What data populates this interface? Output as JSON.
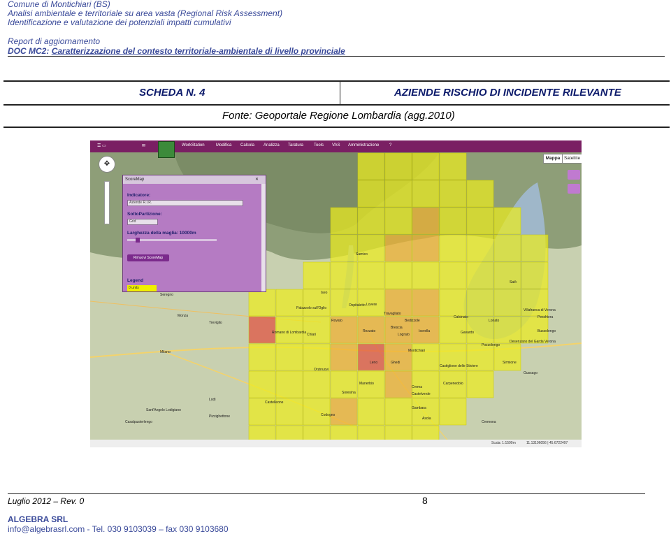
{
  "header": {
    "line1": "Comune di Montichiari (BS)",
    "line2": "Analisi ambientale e territoriale su area vasta (Regional Risk Assessment)",
    "line3": "Identificazione e valutazione dei potenziali impatti cumulativi",
    "line4": "Report di aggiornamento",
    "line5_prefix": "DOC MC2:",
    "line5_title": "Caratterizzazione del contesto territoriale-ambientale di livello provinciale"
  },
  "scheda": {
    "number": "SCHEDA N. 4",
    "title": "AZIENDE RISCHIO DI INCIDENTE RILEVANTE",
    "source": "Fonte: Geoportale Regione Lombardia (agg.2010)"
  },
  "map": {
    "toolbar": [
      "WorkStation",
      "Modifica",
      "Calcola",
      "Analizza",
      "Taratura",
      "Tools",
      "VAS",
      "Amministrazione",
      "?"
    ],
    "map_types": [
      "Mappa",
      "Satellite"
    ],
    "panel": {
      "title": "ScoreMap",
      "indicator_label": "Indicatore:",
      "indicator_value": "Aziende R.I.R.",
      "subpartition_label": "SottoPartizione:",
      "subpartition_value": "Grid",
      "mesh_label": "Larghezza della maglia: 10000m",
      "remove_button": "Rimuovi ScoreMap",
      "legend_label": "Legend",
      "legend_item": "0 units"
    },
    "place_labels": [
      "Milano",
      "Monza",
      "Seregno",
      "Brescia",
      "Chiari",
      "Rovato",
      "Lodi",
      "Crema",
      "Treviglio",
      "Romano di Lombardia",
      "Salò",
      "Lonato",
      "Desenzano del Garda",
      "Verona",
      "Palazzolo sull'Oglio",
      "Ghedi",
      "Montichiari",
      "Leno",
      "Manerbio",
      "Orzinuovi",
      "Castiglione delle Stiviere",
      "Carpenedolo",
      "Asola",
      "Gambara",
      "Cremona",
      "Soresina",
      "Lograto",
      "Bussolengo",
      "Castelleone",
      "Pizzighettone",
      "Sant'Angelo Lodigiano",
      "Casalpusterlengo",
      "Codogno",
      "Castelverde",
      "Isorella",
      "Calcinato",
      "Gavardo",
      "Bedizzole",
      "Rezzato",
      "Travagliato",
      "Ospitaletto",
      "Iseo",
      "Sarnico",
      "Lovere",
      "Gussago",
      "Villafranca di Verona",
      "Peschiera",
      "Sirmione",
      "Pozzolengo"
    ],
    "status": "Scala: 1:1590m",
    "coords": "11.13106056 | 45.6722497"
  },
  "footer": {
    "date": "Luglio 2012 – Rev. 0",
    "page": "8",
    "company": "ALGEBRA SRL",
    "contact": "info@algebrasrl.com - Tel. 030 9103039 – fax 030 9103680"
  },
  "colors": {
    "header_text": "#3a4a9a",
    "scheda_text": "#0c1a6b",
    "toolbar": "#7a1f63",
    "panel": "#b57bc3",
    "grid_low": "#ecec1e",
    "grid_mid": "#f0b030",
    "grid_high": "#e05040"
  }
}
